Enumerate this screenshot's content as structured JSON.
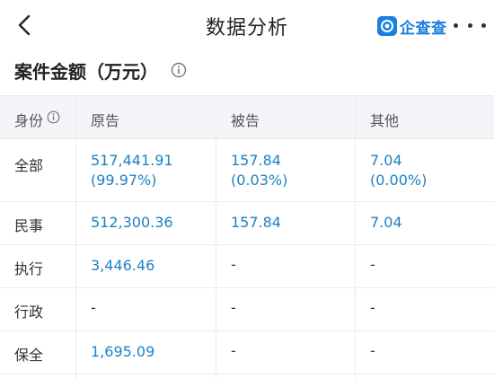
{
  "header": {
    "title": "数据分析",
    "brand_name": "企查查"
  },
  "section": {
    "title": "案件金额（万元）"
  },
  "table": {
    "headers": [
      "身份",
      "原告",
      "被告",
      "其他"
    ],
    "rows": [
      {
        "label": "全部",
        "plaintiff": "517,441.91",
        "plaintiff_pct": "(99.97%)",
        "defendant": "157.84",
        "defendant_pct": "(0.03%)",
        "other": "7.04",
        "other_pct": "(0.00%)"
      },
      {
        "label": "民事",
        "plaintiff": "512,300.36",
        "defendant": "157.84",
        "other": "7.04"
      },
      {
        "label": "执行",
        "plaintiff": "3,446.46",
        "defendant": "-",
        "other": "-"
      },
      {
        "label": "行政",
        "plaintiff": "-",
        "defendant": "-",
        "other": "-"
      },
      {
        "label": "保全",
        "plaintiff": "1,695.09",
        "defendant": "-",
        "other": "-"
      }
    ]
  },
  "colors": {
    "value": "#1b82c4",
    "brand": "#1a7fe0",
    "header_bg": "#f3f5f8"
  }
}
